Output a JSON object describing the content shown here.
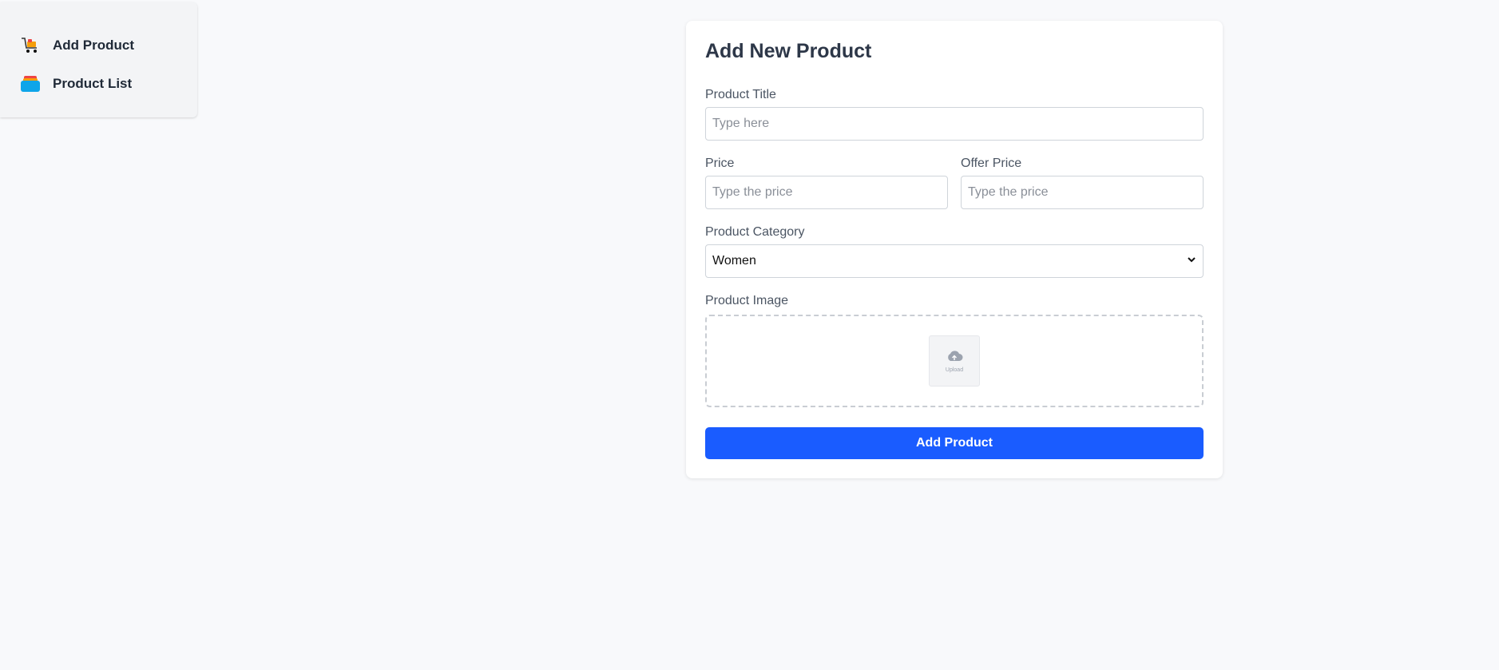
{
  "sidebar": {
    "items": [
      {
        "label": "Add Product",
        "icon": "cart-icon"
      },
      {
        "label": "Product List",
        "icon": "product-list-icon"
      }
    ]
  },
  "form": {
    "title": "Add New Product",
    "product_title": {
      "label": "Product Title",
      "placeholder": "Type here",
      "value": ""
    },
    "price": {
      "label": "Price",
      "placeholder": "Type the price",
      "value": ""
    },
    "offer_price": {
      "label": "Offer Price",
      "placeholder": "Type the price",
      "value": ""
    },
    "category": {
      "label": "Product Category",
      "selected": "Women"
    },
    "image": {
      "label": "Product Image",
      "upload_text": "Upload"
    },
    "submit_label": "Add Product"
  },
  "colors": {
    "primary": "#1a5cff",
    "background": "#f8f9fb",
    "sidebar_bg": "#f3f4f6"
  }
}
